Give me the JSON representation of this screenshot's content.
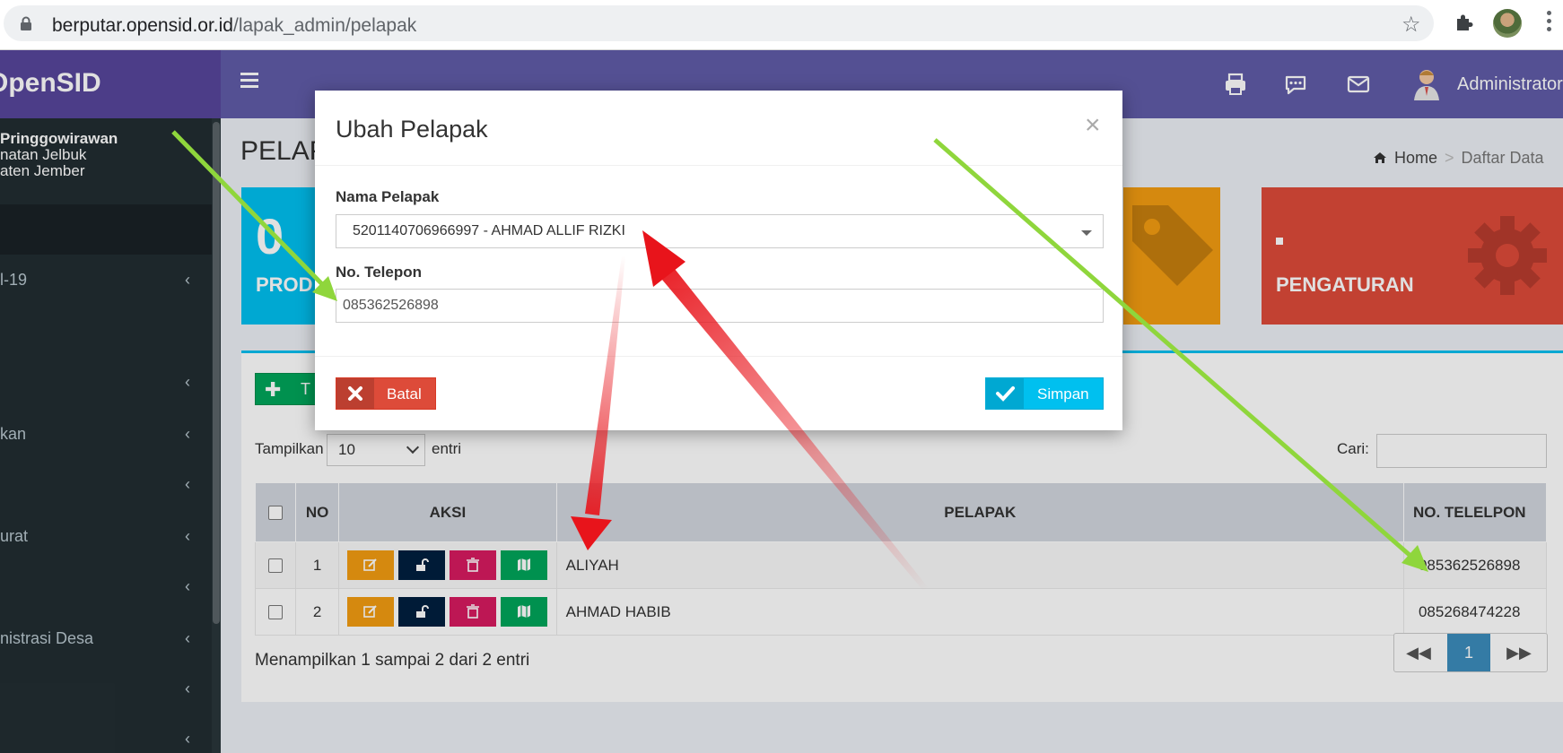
{
  "browser": {
    "url_host": "berputar.opensid.or.id",
    "url_path": "/lapak_admin/pelapak"
  },
  "header": {
    "logo": "OpenSID",
    "user": "Administrator"
  },
  "sidebar": {
    "user_name": "Pringgowirawan",
    "user_line2": "natan Jelbuk",
    "user_line3": "aten Jember",
    "items": [
      {
        "label": "l-19"
      },
      {
        "label": ""
      },
      {
        "label": "kan"
      },
      {
        "label": ""
      },
      {
        "label": "urat"
      },
      {
        "label": ""
      },
      {
        "label": "nistrasi Desa"
      },
      {
        "label": ""
      },
      {
        "label": ""
      }
    ]
  },
  "content": {
    "title": "PELAP",
    "breadcrumb_home": "Home",
    "breadcrumb_current": "Daftar Data",
    "box_produk_value": "0",
    "box_produk_label": "PROD",
    "box_pengaturan_label": "PENGATURAN",
    "add_button": "T",
    "show_label": "Tampilkan",
    "show_value": "10",
    "entries_label": "entri",
    "search_label": "Cari:",
    "columns": [
      "NO",
      "AKSI",
      "PELAPAK",
      "NO. TELELPON"
    ],
    "rows": [
      {
        "no": "1",
        "pelapak": "ALIYAH",
        "telepon": "085362526898"
      },
      {
        "no": "2",
        "pelapak": "AHMAD HABIB",
        "telepon": "085268474228"
      }
    ],
    "info": "Menampilkan 1 sampai 2 dari 2 entri",
    "page": "1"
  },
  "modal": {
    "title": "Ubah Pelapak",
    "close": "×",
    "field_nama_label": "Nama Pelapak",
    "field_nama_value": "5201140706966997 - AHMAD ALLIF RIZKI",
    "field_telepon_label": "No. Telepon",
    "field_telepon_value": "085362526898",
    "btn_cancel": "Batal",
    "btn_save": "Simpan"
  },
  "colors": {
    "header": "#605ca8",
    "logo_bg": "#57469b",
    "sidebar": "#222d32",
    "teal": "#00c0ef",
    "orange": "#f39c12",
    "red": "#dd4b39",
    "green": "#00a65a",
    "arrow_green": "#8fd63c",
    "arrow_red": "#e8141b"
  }
}
